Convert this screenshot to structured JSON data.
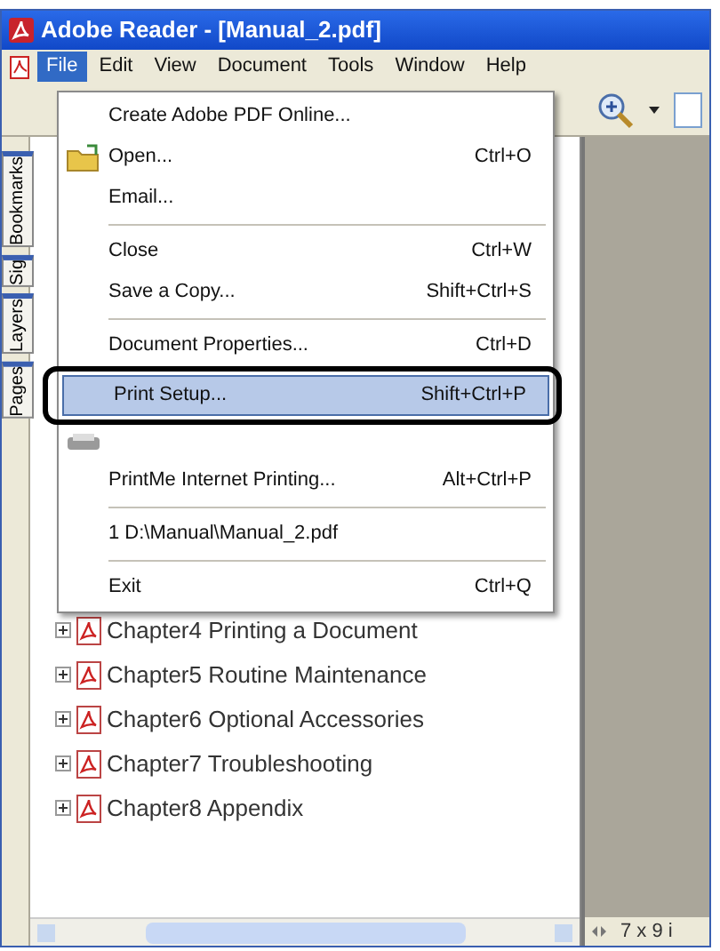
{
  "window": {
    "title": "Adobe Reader - [Manual_2.pdf]"
  },
  "menu_bar": [
    {
      "label": "File",
      "selected": true
    },
    {
      "label": "Edit",
      "selected": false
    },
    {
      "label": "View",
      "selected": false
    },
    {
      "label": "Document",
      "selected": false
    },
    {
      "label": "Tools",
      "selected": false
    },
    {
      "label": "Window",
      "selected": false
    },
    {
      "label": "Help",
      "selected": false
    }
  ],
  "file_menu": [
    {
      "kind": "item",
      "label": "Create Adobe PDF Online...",
      "selected": false
    },
    {
      "kind": "folder_item",
      "label": "Open...",
      "shortcut": "Ctrl+O",
      "selected": false
    },
    {
      "kind": "item",
      "label": "Email...",
      "selected": false
    },
    {
      "kind": "separator"
    },
    {
      "kind": "item",
      "label": "Close",
      "shortcut": "Ctrl+W",
      "selected": false
    },
    {
      "kind": "item",
      "label": "Save a Copy...",
      "shortcut": "Shift+Ctrl+S",
      "selected": false
    },
    {
      "kind": "separator"
    },
    {
      "kind": "item",
      "label": "Document Properties...",
      "shortcut": "Ctrl+D",
      "selected": false
    },
    {
      "kind": "item",
      "label": "Print Setup...",
      "shortcut": "Shift+Ctrl+P",
      "selected": true
    },
    {
      "kind": "hidden"
    },
    {
      "kind": "item",
      "label": "PrintMe Internet Printing...",
      "shortcut": "Alt+Ctrl+P",
      "selected": false
    },
    {
      "kind": "separator"
    },
    {
      "kind": "item",
      "label": "1 D:\\Manual\\Manual_2.pdf",
      "selected": false
    },
    {
      "kind": "separator"
    },
    {
      "kind": "item",
      "label": "Exit",
      "shortcut": "Ctrl+Q",
      "selected": false
    }
  ],
  "side_tabs": [
    {
      "label": "Bookmarks"
    },
    {
      "label": "Sig"
    },
    {
      "label": "Layers"
    },
    {
      "label": "Pages"
    }
  ],
  "bookmarks": [
    {
      "label": "Chapter4 Printing a Document"
    },
    {
      "label": "Chapter5 Routine Maintenance"
    },
    {
      "label": "Chapter6 Optional Accessories"
    },
    {
      "label": "Chapter7 Troubleshooting"
    },
    {
      "label": "Chapter8 Appendix"
    }
  ],
  "status_bar": {
    "page_size": "7 x 9 i"
  }
}
